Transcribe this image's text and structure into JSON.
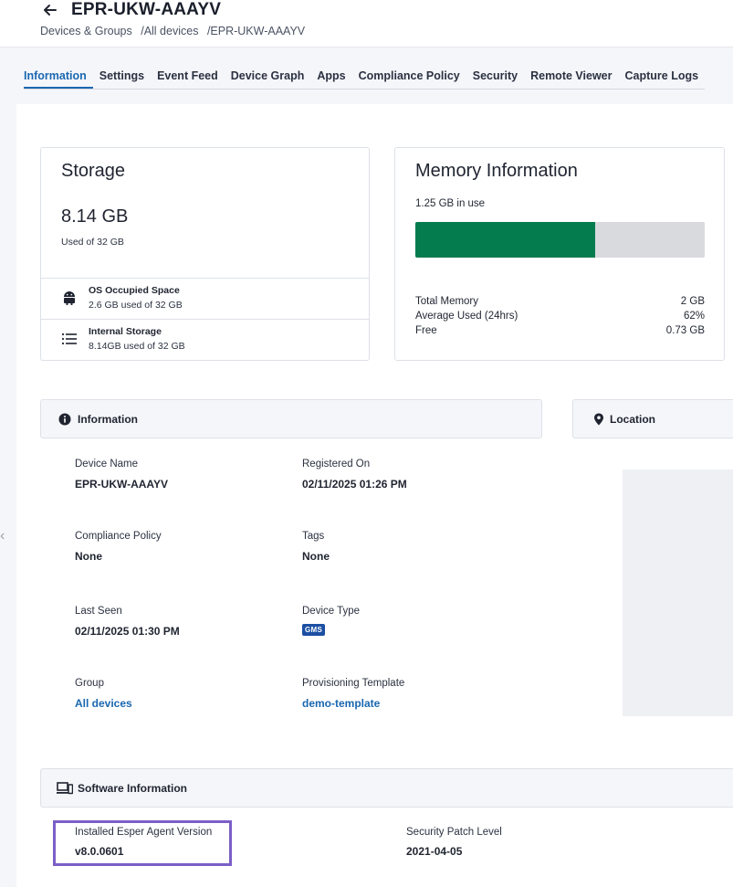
{
  "header": {
    "title": "EPR-UKW-AAAYV",
    "breadcrumb": [
      "Devices & Groups",
      "/All devices",
      "/EPR-UKW-AAAYV"
    ]
  },
  "tabs": [
    {
      "label": "Information",
      "active": true
    },
    {
      "label": "Settings"
    },
    {
      "label": "Event Feed"
    },
    {
      "label": "Device Graph"
    },
    {
      "label": "Apps"
    },
    {
      "label": "Compliance Policy"
    },
    {
      "label": "Security"
    },
    {
      "label": "Remote Viewer"
    },
    {
      "label": "Capture Logs"
    }
  ],
  "storage": {
    "heading": "Storage",
    "value": "8.14 GB",
    "sub": "Used of 32 GB",
    "rows": [
      {
        "label": "OS Occupied Space",
        "value": "2.6 GB used of 32 GB",
        "icon": "android-icon"
      },
      {
        "label": "Internal Storage",
        "value": "8.14GB used of 32 GB",
        "icon": "list-icon"
      }
    ]
  },
  "memory": {
    "heading": "Memory Information",
    "in_use": "1.25 GB in use",
    "used_fraction": 0.62,
    "stats": [
      {
        "label": "Total Memory",
        "value": "2 GB"
      },
      {
        "label": "Average Used (24hrs)",
        "value": "62%"
      },
      {
        "label": "Free",
        "value": "0.73 GB"
      }
    ]
  },
  "information": {
    "title": "Information",
    "fields": {
      "device_name": {
        "label": "Device Name",
        "value": "EPR-UKW-AAAYV"
      },
      "registered_on": {
        "label": "Registered On",
        "value": "02/11/2025 01:26 PM"
      },
      "compliance_policy": {
        "label": "Compliance Policy",
        "value": "None"
      },
      "tags": {
        "label": "Tags",
        "value": "None"
      },
      "last_seen": {
        "label": "Last Seen",
        "value": "02/11/2025 01:30 PM"
      },
      "device_type": {
        "label": "Device Type",
        "value": "GMS"
      },
      "group": {
        "label": "Group",
        "value": "All devices"
      },
      "provisioning_template": {
        "label": "Provisioning Template",
        "value": "demo-template"
      }
    }
  },
  "location": {
    "title": "Location"
  },
  "software": {
    "title": "Software Information",
    "agent_version": {
      "label": "Installed Esper Agent Version",
      "value": "v8.0.0601"
    },
    "security_patch": {
      "label": "Security Patch Level",
      "value": "2021-04-05"
    }
  },
  "colors": {
    "accent": "#1a67b0",
    "memory_fill": "#047c4e",
    "highlight": "#7b5fc7",
    "badge": "#1b4fa3"
  }
}
